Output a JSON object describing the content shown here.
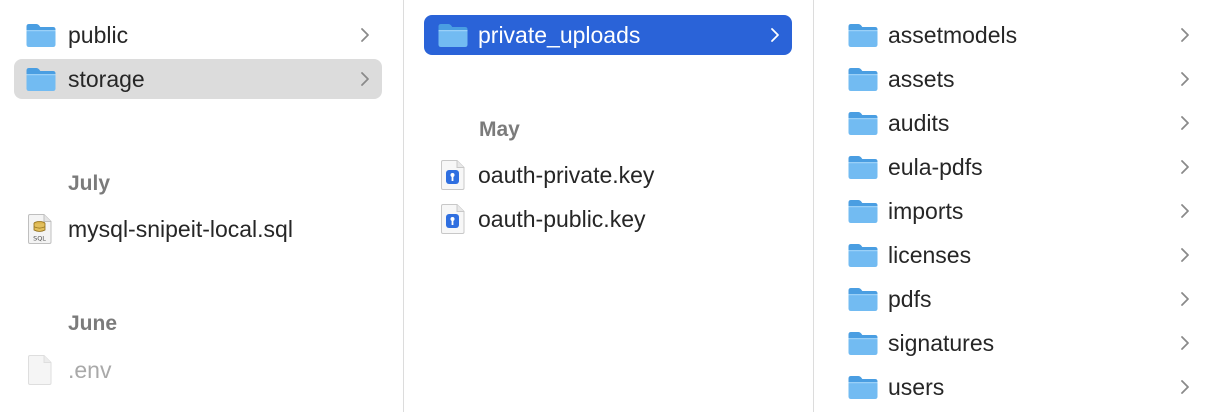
{
  "columns": {
    "col1": {
      "items": [
        {
          "name": "public"
        },
        {
          "name": "storage"
        }
      ],
      "sections": [
        {
          "label": "July",
          "items": [
            {
              "name": "mysql-snipeit-local.sql",
              "icon": "sql-file-icon"
            }
          ]
        },
        {
          "label": "June",
          "items": [
            {
              "name": ".env",
              "icon": "blank-file-icon"
            }
          ]
        }
      ]
    },
    "col2": {
      "items": [
        {
          "name": "private_uploads"
        }
      ],
      "sections": [
        {
          "label": "May",
          "items": [
            {
              "name": "oauth-private.key",
              "icon": "key-file-icon"
            },
            {
              "name": "oauth-public.key",
              "icon": "key-file-icon"
            }
          ]
        }
      ]
    },
    "col3": {
      "items": [
        {
          "name": "assetmodels"
        },
        {
          "name": "assets"
        },
        {
          "name": "audits"
        },
        {
          "name": "eula-pdfs"
        },
        {
          "name": "imports"
        },
        {
          "name": "licenses"
        },
        {
          "name": "pdfs"
        },
        {
          "name": "signatures"
        },
        {
          "name": "users"
        }
      ]
    }
  },
  "icons": {
    "folder": "folder-icon",
    "chevron": "chevron-right-icon"
  },
  "colors": {
    "selection_blue": "#2a63d8",
    "selection_gray": "#dcdcdc",
    "folder_blue": "#6ab7f0",
    "section_text": "#7b7b7b",
    "dim_text": "#a9a9a9"
  }
}
